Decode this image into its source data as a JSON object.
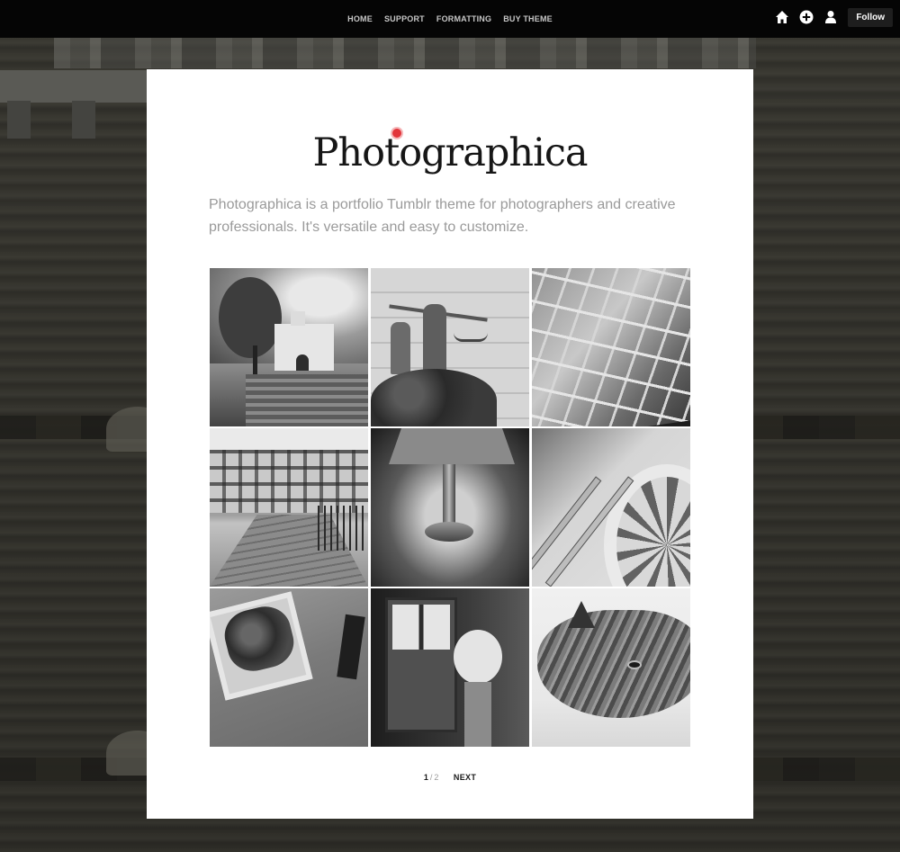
{
  "nav": {
    "items": [
      {
        "label": "HOME"
      },
      {
        "label": "SUPPORT"
      },
      {
        "label": "FORMATTING"
      },
      {
        "label": "BUY THEME"
      }
    ]
  },
  "toolbar": {
    "icons": [
      "home-icon",
      "plus-circle-icon",
      "user-icon"
    ],
    "follow_label": "Follow"
  },
  "header": {
    "title": "Photographica",
    "accent_color": "#e2343a",
    "description": "Photographica is a portfolio Tumblr theme for photographers and creative professionals. It's versatile and easy to customize."
  },
  "grid": {
    "columns": 3,
    "rows": 3
  },
  "pagination": {
    "current": "1",
    "separator": "/",
    "total": "2",
    "next_label": "NEXT"
  }
}
